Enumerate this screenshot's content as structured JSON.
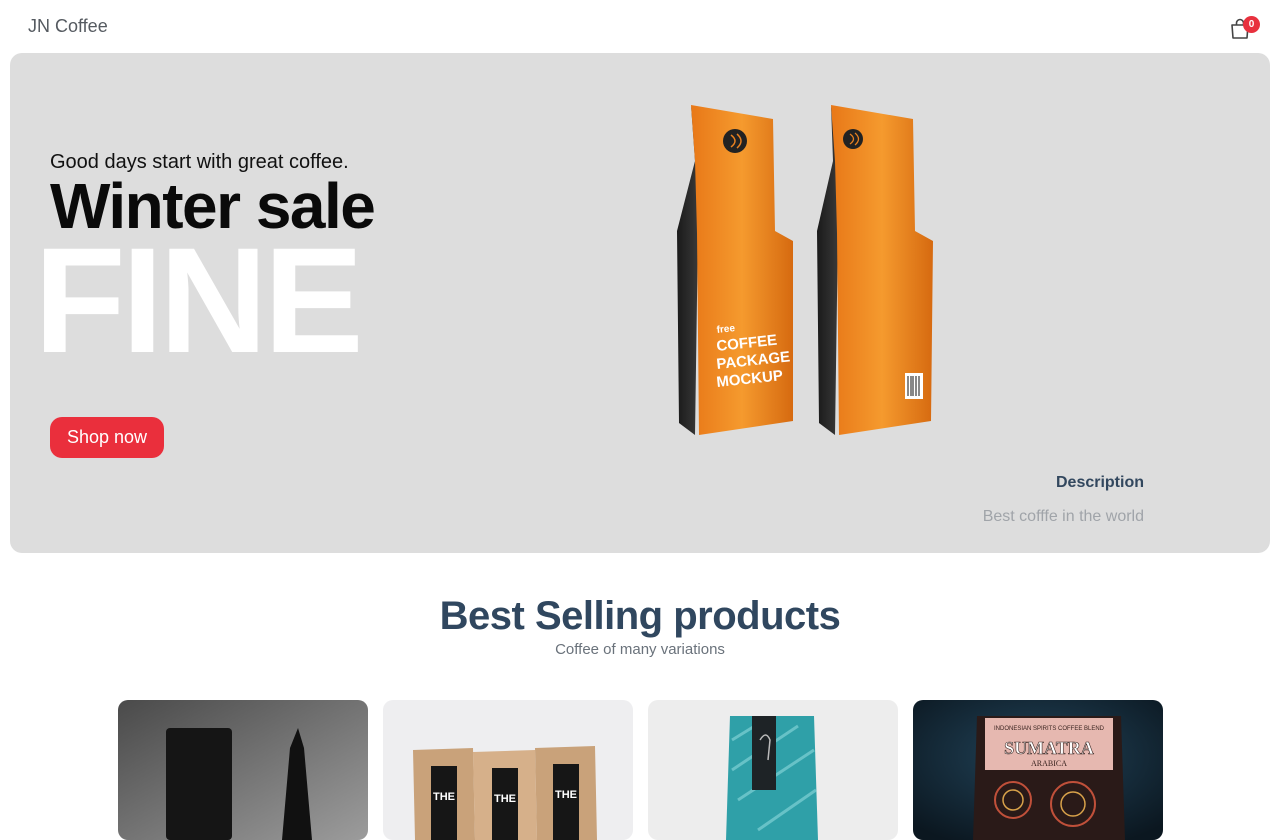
{
  "header": {
    "brand": "JN Coffee",
    "cart_count": "0"
  },
  "hero": {
    "tagline": "Good days start with great coffee.",
    "title": "Winter sale",
    "big_word": "FINE",
    "cta_label": "Shop now",
    "product_text": [
      "free",
      "COFFEE",
      "PACKAGE",
      "MOCKUP"
    ],
    "description_title": "Description",
    "description_text": "Best cofffe in the world"
  },
  "section": {
    "title": "Best Selling products",
    "subtitle": "Coffee of many variations"
  },
  "products": [
    {
      "image": "black-coffee-bags"
    },
    {
      "image": "kraft-coffee-bags",
      "label": "THE"
    },
    {
      "image": "teal-coffee-bag"
    },
    {
      "image": "sumatra-coffee-bag",
      "label": "SUMATRA",
      "sublabel": "ARABICA",
      "top_text": "INDONESIAN SPIRITS COFFEE BLEND"
    }
  ],
  "colors": {
    "accent": "#ea2f3c",
    "heading": "#30475f",
    "hero_bg": "#dddddd",
    "bag_orange": "#f08a1c"
  }
}
